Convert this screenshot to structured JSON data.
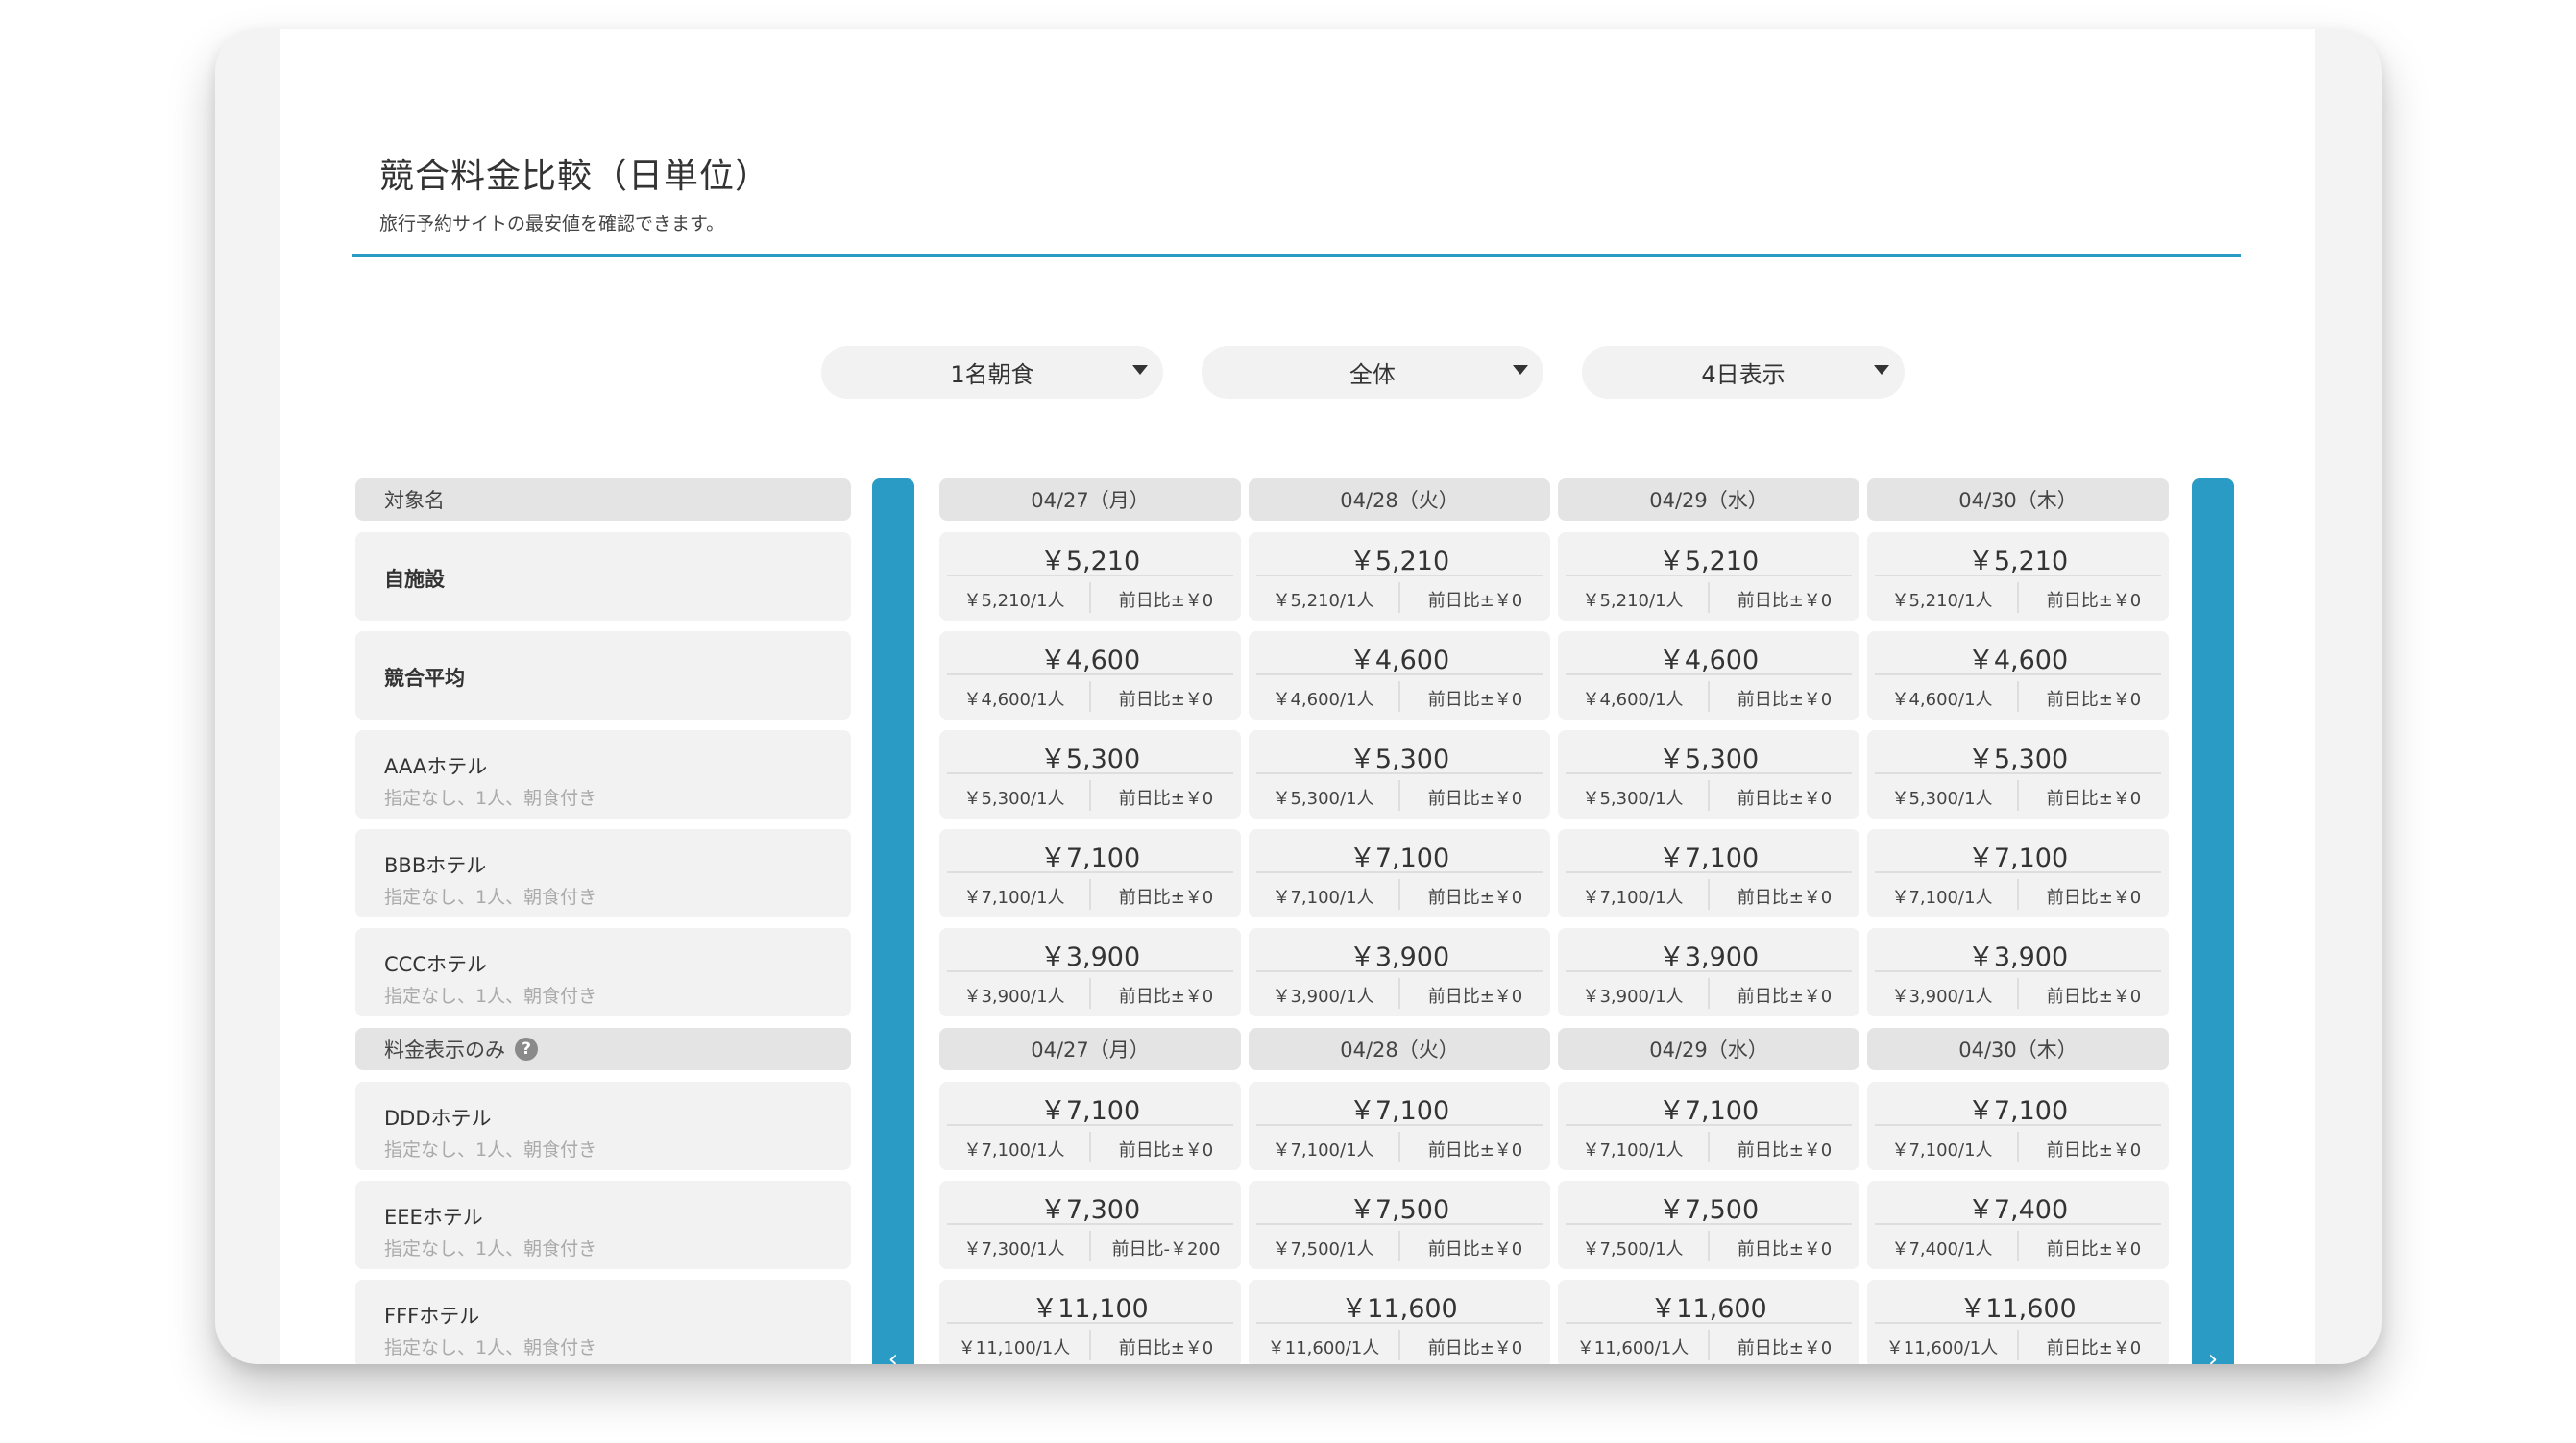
{
  "header": {
    "title": "競合料金比較（日単位）",
    "subtitle": "旅行予約サイトの最安値を確認できます。"
  },
  "filters": [
    {
      "value": "1名朝食"
    },
    {
      "value": "全体"
    },
    {
      "value": "4日表示"
    }
  ],
  "table": {
    "name_header": "対象名",
    "price_only_label": "料金表示のみ",
    "dates": [
      "04/27（月）",
      "04/28（火）",
      "04/29（水）",
      "04/30（木）"
    ],
    "rows": [
      {
        "name": "自施設",
        "bold": true,
        "sub": "",
        "cells": [
          {
            "price": "￥5,210",
            "unit": "￥5,210/1人",
            "diff": "前日比±￥0"
          },
          {
            "price": "￥5,210",
            "unit": "￥5,210/1人",
            "diff": "前日比±￥0"
          },
          {
            "price": "￥5,210",
            "unit": "￥5,210/1人",
            "diff": "前日比±￥0"
          },
          {
            "price": "￥5,210",
            "unit": "￥5,210/1人",
            "diff": "前日比±￥0"
          }
        ]
      },
      {
        "name": "競合平均",
        "bold": true,
        "sub": "",
        "cells": [
          {
            "price": "￥4,600",
            "unit": "￥4,600/1人",
            "diff": "前日比±￥0"
          },
          {
            "price": "￥4,600",
            "unit": "￥4,600/1人",
            "diff": "前日比±￥0"
          },
          {
            "price": "￥4,600",
            "unit": "￥4,600/1人",
            "diff": "前日比±￥0"
          },
          {
            "price": "￥4,600",
            "unit": "￥4,600/1人",
            "diff": "前日比±￥0"
          }
        ]
      },
      {
        "name": "AAAホテル",
        "bold": false,
        "sub": "指定なし、1人、朝食付き",
        "cells": [
          {
            "price": "￥5,300",
            "unit": "￥5,300/1人",
            "diff": "前日比±￥0"
          },
          {
            "price": "￥5,300",
            "unit": "￥5,300/1人",
            "diff": "前日比±￥0"
          },
          {
            "price": "￥5,300",
            "unit": "￥5,300/1人",
            "diff": "前日比±￥0"
          },
          {
            "price": "￥5,300",
            "unit": "￥5,300/1人",
            "diff": "前日比±￥0"
          }
        ]
      },
      {
        "name": "BBBホテル",
        "bold": false,
        "sub": "指定なし、1人、朝食付き",
        "cells": [
          {
            "price": "￥7,100",
            "unit": "￥7,100/1人",
            "diff": "前日比±￥0"
          },
          {
            "price": "￥7,100",
            "unit": "￥7,100/1人",
            "diff": "前日比±￥0"
          },
          {
            "price": "￥7,100",
            "unit": "￥7,100/1人",
            "diff": "前日比±￥0"
          },
          {
            "price": "￥7,100",
            "unit": "￥7,100/1人",
            "diff": "前日比±￥0"
          }
        ]
      },
      {
        "name": "CCCホテル",
        "bold": false,
        "sub": "指定なし、1人、朝食付き",
        "cells": [
          {
            "price": "￥3,900",
            "unit": "￥3,900/1人",
            "diff": "前日比±￥0"
          },
          {
            "price": "￥3,900",
            "unit": "￥3,900/1人",
            "diff": "前日比±￥0"
          },
          {
            "price": "￥3,900",
            "unit": "￥3,900/1人",
            "diff": "前日比±￥0"
          },
          {
            "price": "￥3,900",
            "unit": "￥3,900/1人",
            "diff": "前日比±￥0"
          }
        ]
      }
    ],
    "price_only_rows": [
      {
        "name": "DDDホテル",
        "sub": "指定なし、1人、朝食付き",
        "cells": [
          {
            "price": "￥7,100",
            "unit": "￥7,100/1人",
            "diff": "前日比±￥0"
          },
          {
            "price": "￥7,100",
            "unit": "￥7,100/1人",
            "diff": "前日比±￥0"
          },
          {
            "price": "￥7,100",
            "unit": "￥7,100/1人",
            "diff": "前日比±￥0"
          },
          {
            "price": "￥7,100",
            "unit": "￥7,100/1人",
            "diff": "前日比±￥0"
          }
        ]
      },
      {
        "name": "EEEホテル",
        "sub": "指定なし、1人、朝食付き",
        "cells": [
          {
            "price": "￥7,300",
            "unit": "￥7,300/1人",
            "diff": "前日比-￥200"
          },
          {
            "price": "￥7,500",
            "unit": "￥7,500/1人",
            "diff": "前日比±￥0"
          },
          {
            "price": "￥7,500",
            "unit": "￥7,500/1人",
            "diff": "前日比±￥0"
          },
          {
            "price": "￥7,400",
            "unit": "￥7,400/1人",
            "diff": "前日比±￥0"
          }
        ]
      },
      {
        "name": "FFFホテル",
        "sub": "指定なし、1人、朝食付き",
        "cells": [
          {
            "price": "￥11,100",
            "unit": "￥11,100/1人",
            "diff": "前日比±￥0"
          },
          {
            "price": "￥11,600",
            "unit": "￥11,600/1人",
            "diff": "前日比±￥0"
          },
          {
            "price": "￥11,600",
            "unit": "￥11,600/1人",
            "diff": "前日比±￥0"
          },
          {
            "price": "￥11,600",
            "unit": "￥11,600/1人",
            "diff": "前日比±￥0"
          }
        ]
      },
      {
        "name": "",
        "sub": "",
        "cells": [
          {
            "price": "",
            "unit": "",
            "diff": ""
          },
          {
            "price": "",
            "unit": "",
            "diff": ""
          },
          {
            "price": "",
            "unit": "",
            "diff": ""
          },
          {
            "price": "",
            "unit": "",
            "diff": ""
          }
        ]
      }
    ]
  },
  "nav": {
    "prev_icon": "chevron-left-icon",
    "next_icon": "chevron-right-icon"
  },
  "colors": {
    "accent": "#2a9bc4",
    "cell_bg": "#f2f2f2",
    "header_bg": "#e4e4e4"
  }
}
